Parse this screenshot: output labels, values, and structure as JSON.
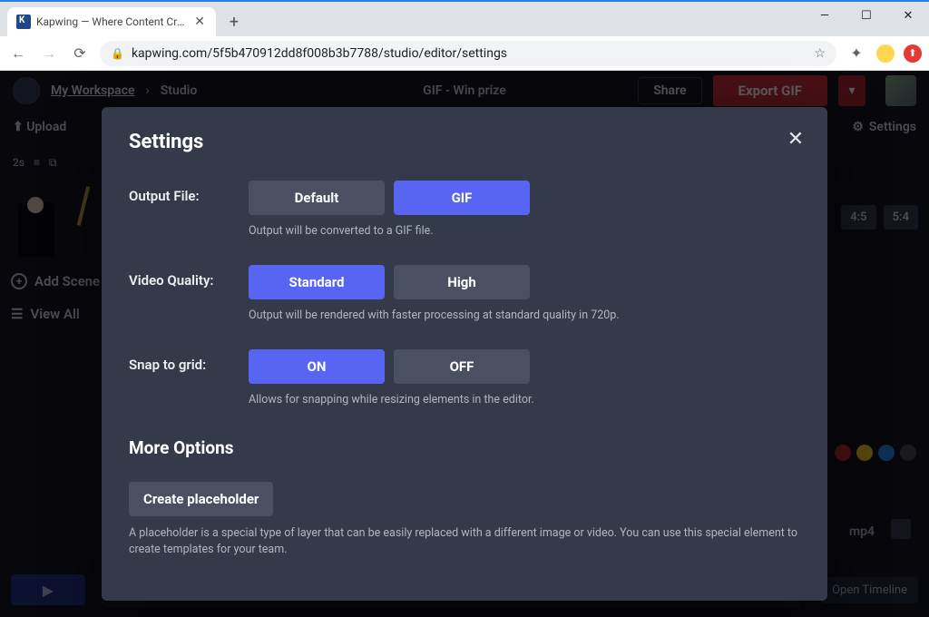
{
  "browser": {
    "tab_title": "Kapwing — Where Content Crea",
    "url": "kapwing.com/5f5b470912dd8f008b3b7788/studio/editor/settings"
  },
  "app": {
    "workspace_link": "My Workspace",
    "breadcrumb_sep": "›",
    "breadcrumb_page": "Studio",
    "project_title": "GIF - Win prize",
    "share_label": "Share",
    "export_label": "Export GIF",
    "upload_label": "Upload",
    "settings_label": "Settings",
    "timeline_time": "2s",
    "add_scene_label": "Add Scene",
    "view_all_label": "View All",
    "ratios": [
      "4:5",
      "5:4"
    ],
    "open_timeline_label": "Open Timeline",
    "format_chip": "mp4"
  },
  "modal": {
    "title": "Settings",
    "output": {
      "label": "Output File:",
      "option_default": "Default",
      "option_gif": "GIF",
      "hint": "Output will be converted to a GIF file."
    },
    "quality": {
      "label": "Video Quality:",
      "option_standard": "Standard",
      "option_high": "High",
      "hint": "Output will be rendered with faster processing at standard quality in 720p."
    },
    "snap": {
      "label": "Snap to grid:",
      "option_on": "ON",
      "option_off": "OFF",
      "hint": "Allows for snapping while resizing elements in the editor."
    },
    "more_title": "More Options",
    "create_placeholder_label": "Create placeholder",
    "placeholder_desc": "A placeholder is a special type of layer that can be easily replaced with a different image or video. You can use this special element to create templates for your team."
  }
}
